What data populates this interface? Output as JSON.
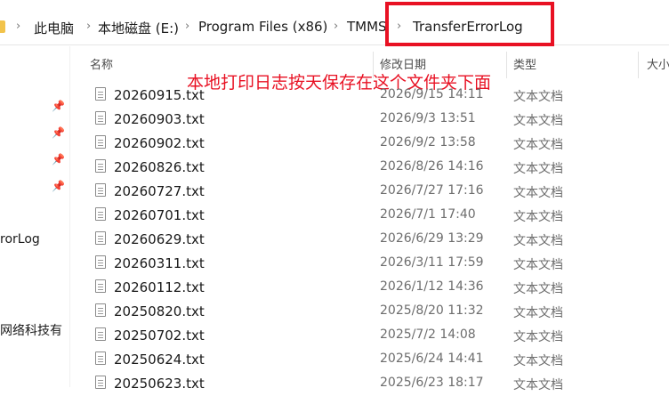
{
  "address_bar": {
    "crumbs": [
      "此电脑",
      "本地磁盘 (E:)",
      "Program Files (x86)",
      "TMMS",
      "TransferErrorLog"
    ]
  },
  "columns": {
    "name": "名称",
    "date_modified": "修改日期",
    "type": "类型",
    "size": "大小"
  },
  "annotation": "本地打印日志按天保存在这个文件夹下面",
  "left_pane": {
    "items": [
      "rorLog",
      "网络科技有"
    ]
  },
  "files": [
    {
      "name": "20260915.txt",
      "date": "2026/9/15 14:11",
      "type": "文本文档"
    },
    {
      "name": "20260903.txt",
      "date": "2026/9/3 13:51",
      "type": "文本文档"
    },
    {
      "name": "20260902.txt",
      "date": "2026/9/2 13:58",
      "type": "文本文档"
    },
    {
      "name": "20260826.txt",
      "date": "2026/8/26 14:16",
      "type": "文本文档"
    },
    {
      "name": "20260727.txt",
      "date": "2026/7/27 17:16",
      "type": "文本文档"
    },
    {
      "name": "20260701.txt",
      "date": "2026/7/1 17:40",
      "type": "文本文档"
    },
    {
      "name": "20260629.txt",
      "date": "2026/6/29 13:29",
      "type": "文本文档"
    },
    {
      "name": "20260311.txt",
      "date": "2026/3/11 17:59",
      "type": "文本文档"
    },
    {
      "name": "20260112.txt",
      "date": "2026/1/12 14:36",
      "type": "文本文档"
    },
    {
      "name": "20250820.txt",
      "date": "2025/8/20 11:32",
      "type": "文本文档"
    },
    {
      "name": "20250702.txt",
      "date": "2025/7/2 14:08",
      "type": "文本文档"
    },
    {
      "name": "20250624.txt",
      "date": "2025/6/24 14:41",
      "type": "文本文档"
    },
    {
      "name": "20250623.txt",
      "date": "2025/6/23 18:17",
      "type": "文本文档"
    }
  ]
}
